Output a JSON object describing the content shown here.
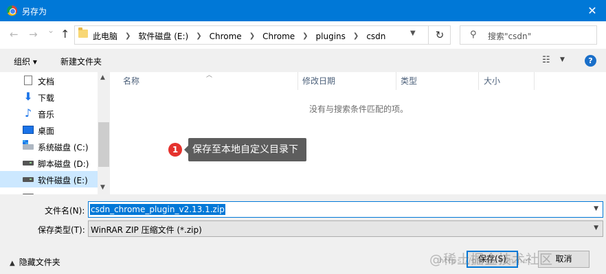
{
  "window": {
    "title": "另存为",
    "close_glyph": "✕"
  },
  "nav": {
    "back_glyph": "←",
    "forward_glyph": "→",
    "recent_glyph": "⌄",
    "up_glyph": "↑",
    "breadcrumbs": [
      "此电脑",
      "软件磁盘 (E:)",
      "Chrome",
      "Chrome",
      "plugins",
      "csdn"
    ],
    "refresh_glyph": "↻",
    "search_placeholder": "搜索\"csdn\"",
    "search_icon": "search-icon"
  },
  "toolbar": {
    "organize_label": "组织 ▾",
    "new_folder_label": "新建文件夹",
    "view_glyph": "☷",
    "help_glyph": "?"
  },
  "sidebar": {
    "items": [
      {
        "label": "文档",
        "icon": "document-icon"
      },
      {
        "label": "下载",
        "icon": "download-icon"
      },
      {
        "label": "音乐",
        "icon": "music-icon"
      },
      {
        "label": "桌面",
        "icon": "desktop-icon"
      },
      {
        "label": "系统磁盘 (C:)",
        "icon": "system-drive-icon"
      },
      {
        "label": "脚本磁盘 (D:)",
        "icon": "drive-icon"
      },
      {
        "label": "软件磁盘 (E:)",
        "icon": "drive-icon",
        "selected": true
      }
    ]
  },
  "file_list": {
    "columns": [
      "名称",
      "修改日期",
      "类型",
      "大小"
    ],
    "empty_message": "没有与搜索条件匹配的项。"
  },
  "form": {
    "filename_label": "文件名(N):",
    "filename_value": "csdn_chrome_plugin_v2.13.1.zip",
    "filetype_label": "保存类型(T):",
    "filetype_value": "WinRAR ZIP 压缩文件 (*.zip)"
  },
  "footer": {
    "hide_folders_label": "隐藏文件夹",
    "save_label": "保存(S)",
    "cancel_label": "取消"
  },
  "annotation": {
    "number": "1",
    "text": "保存至本地自定义目录下"
  },
  "watermark": {
    "text": "@稀土掘金技术社区",
    "url": "https://blog.csdn.net"
  },
  "colors": {
    "titlebar": "#0078d7",
    "accent": "#0078d7",
    "badge": "#e5322d"
  }
}
